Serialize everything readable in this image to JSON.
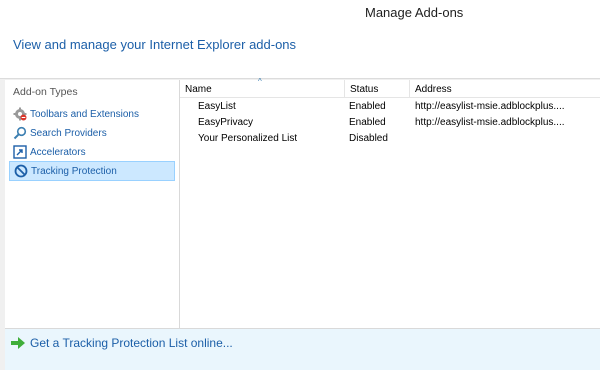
{
  "window": {
    "title": "Manage Add-ons"
  },
  "header": {
    "text": "View and manage your Internet Explorer add-ons"
  },
  "sidebar": {
    "heading": "Add-on Types",
    "items": [
      {
        "label": "Toolbars and Extensions",
        "icon": "gear-icon",
        "selected": false
      },
      {
        "label": "Search Providers",
        "icon": "magnifier-icon",
        "selected": false
      },
      {
        "label": "Accelerators",
        "icon": "accelerator-icon",
        "selected": false
      },
      {
        "label": "Tracking Protection",
        "icon": "no-entry-icon",
        "selected": true
      }
    ]
  },
  "list": {
    "columns": [
      "Name",
      "Status",
      "Address"
    ],
    "sort_indicator": "^",
    "rows": [
      {
        "name": "EasyList",
        "status": "Enabled",
        "address": "http://easylist-msie.adblockplus...."
      },
      {
        "name": "EasyPrivacy",
        "status": "Enabled",
        "address": "http://easylist-msie.adblockplus...."
      },
      {
        "name": "Your Personalized List",
        "status": "Disabled",
        "address": ""
      }
    ]
  },
  "footer": {
    "link": "Get a Tracking Protection List online..."
  },
  "colors": {
    "link": "#1c5fa8",
    "selected_bg": "#cce8ff",
    "footer_bg": "#eaf6fd"
  }
}
